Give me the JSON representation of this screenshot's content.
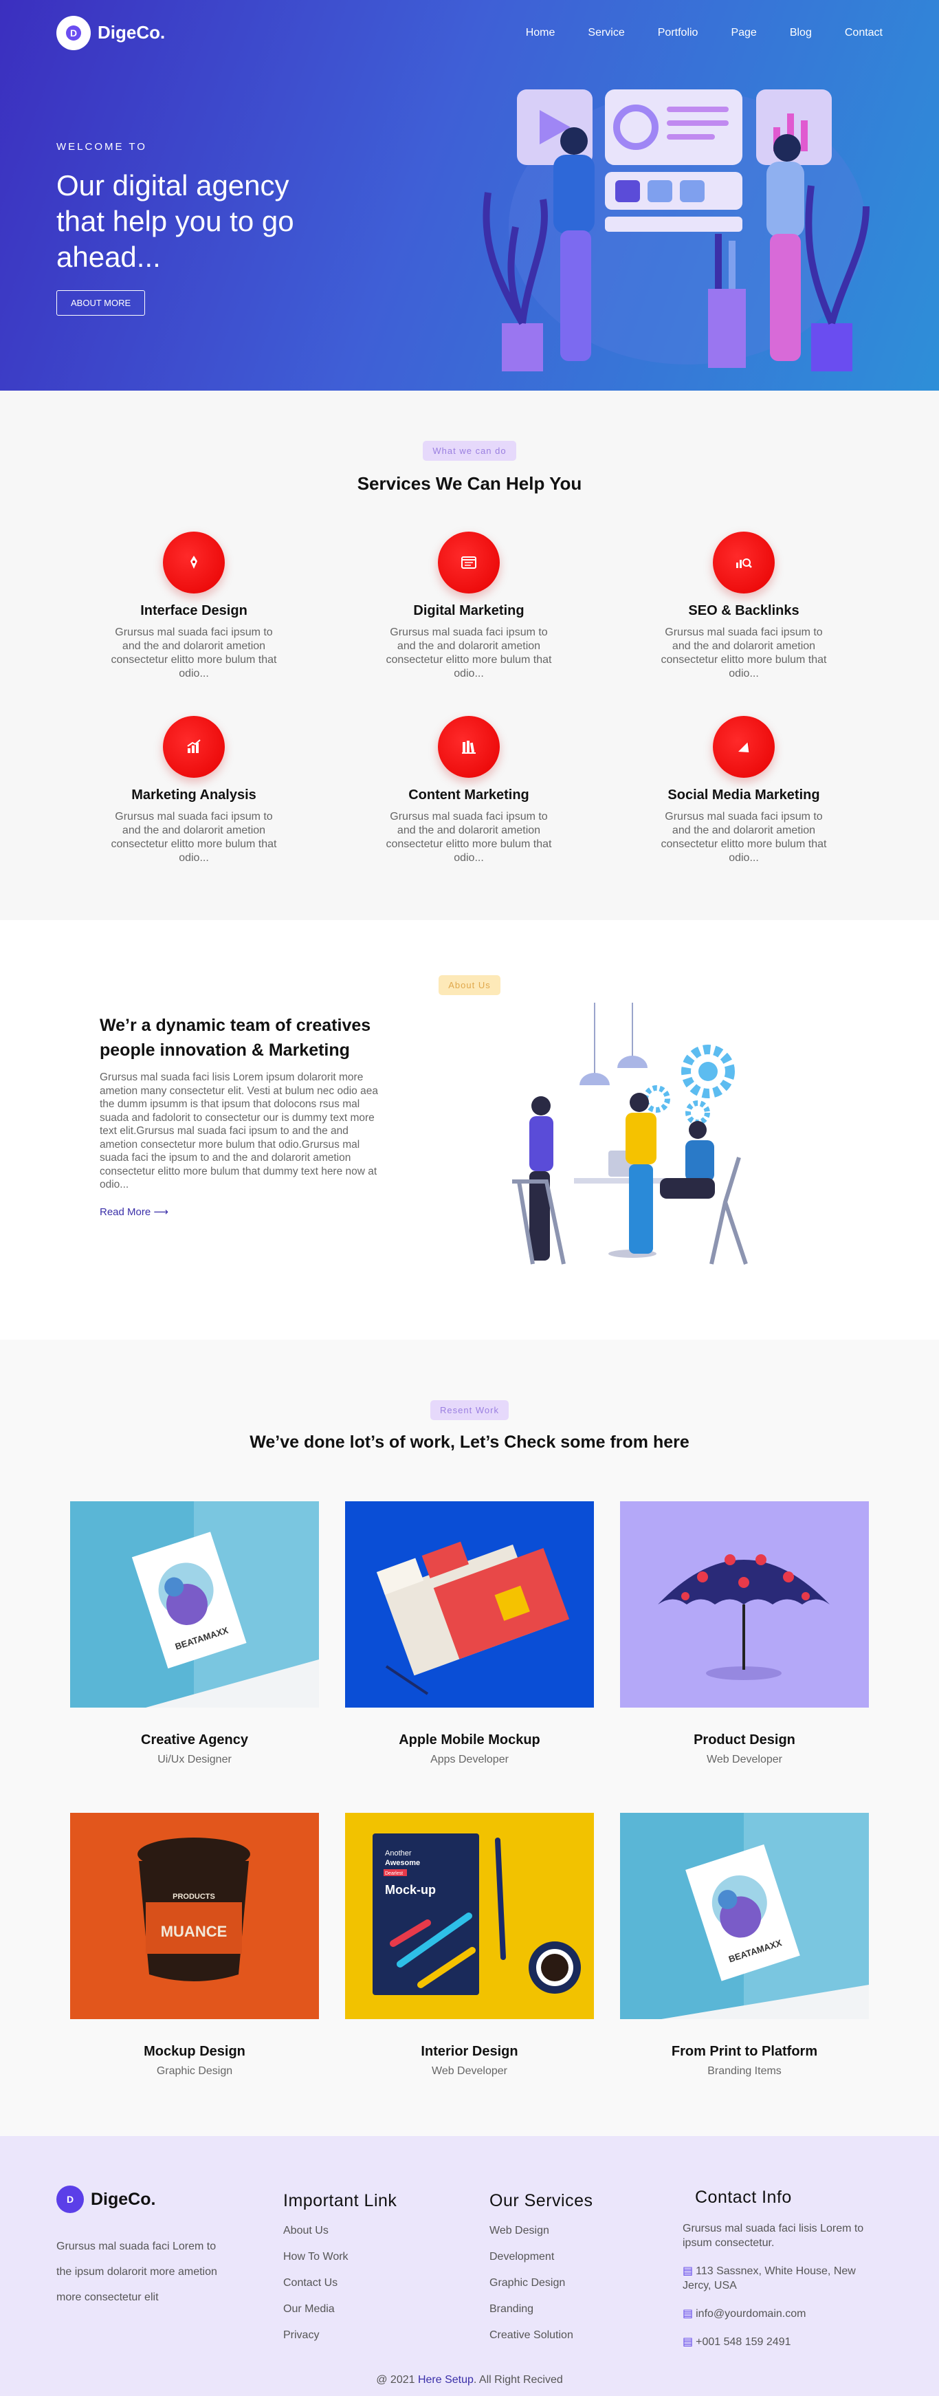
{
  "brand": {
    "name": "DigeCo."
  },
  "nav": {
    "items": [
      "Home",
      "Service",
      "Portfolio",
      "Page",
      "Blog",
      "Contact"
    ]
  },
  "hero": {
    "eyebrow": "WELCOME TO",
    "title": "Our digital agency that help you to go ahead...",
    "button": "ABOUT MORE"
  },
  "services": {
    "tag": "What we can do",
    "title": "Services We Can Help You",
    "items": [
      {
        "title": "Interface Design",
        "text": "Grursus mal suada faci ipsum to and the and dolarorit ametion consectetur elitto more bulum that odio...",
        "icon": "pen-icon"
      },
      {
        "title": "Digital Marketing",
        "text": "Grursus mal suada faci ipsum to and the and dolarorit ametion consectetur elitto more bulum that odio...",
        "icon": "browser-icon"
      },
      {
        "title": "SEO & Backlinks",
        "text": "Grursus mal suada faci ipsum to and the and dolarorit ametion consectetur elitto more bulum that odio...",
        "icon": "seo-icon"
      },
      {
        "title": "Marketing Analysis",
        "text": "Grursus mal suada faci ipsum to and the and dolarorit ametion consectetur elitto more bulum that odio...",
        "icon": "chart-icon"
      },
      {
        "title": "Content Marketing",
        "text": "Grursus mal suada faci ipsum to and the and dolarorit ametion consectetur elitto more bulum that odio...",
        "icon": "books-icon"
      },
      {
        "title": "Social Media Marketing",
        "text": "Grursus mal suada faci ipsum to and the and dolarorit ametion consectetur elitto more bulum that odio...",
        "icon": "megaphone-icon"
      }
    ]
  },
  "about": {
    "tag": "About Us",
    "title": "We’r a dynamic team of creatives people innovation & Marketing",
    "body": "Grursus mal suada faci lisis Lorem ipsum dolarorit more ametion many consectetur elit. Vesti at bulum nec odio aea the dumm ipsumm is that ipsum that dolocons rsus mal suada and fadolorit to consectetur our is dummy text more text elit.Grursus mal suada faci ipsum to and the and ametion consectetur more bulum that odio.Grursus mal suada faci the ipsum to and the and dolarorit ametion consectetur elitto more bulum that dummy text here now at odio...",
    "link": "Read More ⟶"
  },
  "work": {
    "tag": "Resent Work",
    "title": "We’ve done lot’s of work, Let’s Check some from here",
    "items": [
      {
        "title": "Creative Agency",
        "sub": "Ui/Ux Designer"
      },
      {
        "title": "Apple Mobile Mockup",
        "sub": "Apps Developer"
      },
      {
        "title": "Product Design",
        "sub": "Web Developer"
      },
      {
        "title": "Mockup Design",
        "sub": "Graphic Design"
      },
      {
        "title": "Interior Design",
        "sub": "Web Developer"
      },
      {
        "title": "From Print to Platform",
        "sub": "Branding Items"
      }
    ],
    "mock": {
      "poster": "BEATAMAXX",
      "notebook_line1": "Another",
      "notebook_line2": "Awesome",
      "notebook_tag": "Dearlest",
      "notebook_title": "Mock-up",
      "bucket_brand": "MUANCE",
      "bucket_label": "PRODUCTS"
    }
  },
  "footer": {
    "about": "Grursus mal suada faci Lorem to the ipsum dolarorit more ametion more consectetur elit",
    "links_title": "Important Link",
    "links": [
      "About Us",
      "How To Work",
      "Contact Us",
      "Our Media",
      "Privacy"
    ],
    "services_title": "Our Services",
    "services": [
      "Web Design",
      "Development",
      "Graphic Design",
      "Branding",
      "Creative Solution"
    ],
    "contact_title": "Contact Info",
    "contact_text": "Grursus mal suada faci lisis Lorem to ipsum consectetur.",
    "address": "113 Sassnex, White House, New Jercy, USA",
    "email": "info@yourdomain.com",
    "phone": "+001 548 159 2491",
    "copyright_prefix": "@ 2021",
    "copyright_link": "Here Setup",
    "copyright_suffix": ". All Right Recived"
  },
  "colors": {
    "accent": "#5b3fe8",
    "service_icon": "#e60000",
    "hero_start": "#3b2fbf",
    "hero_end": "#2e8fd8"
  }
}
